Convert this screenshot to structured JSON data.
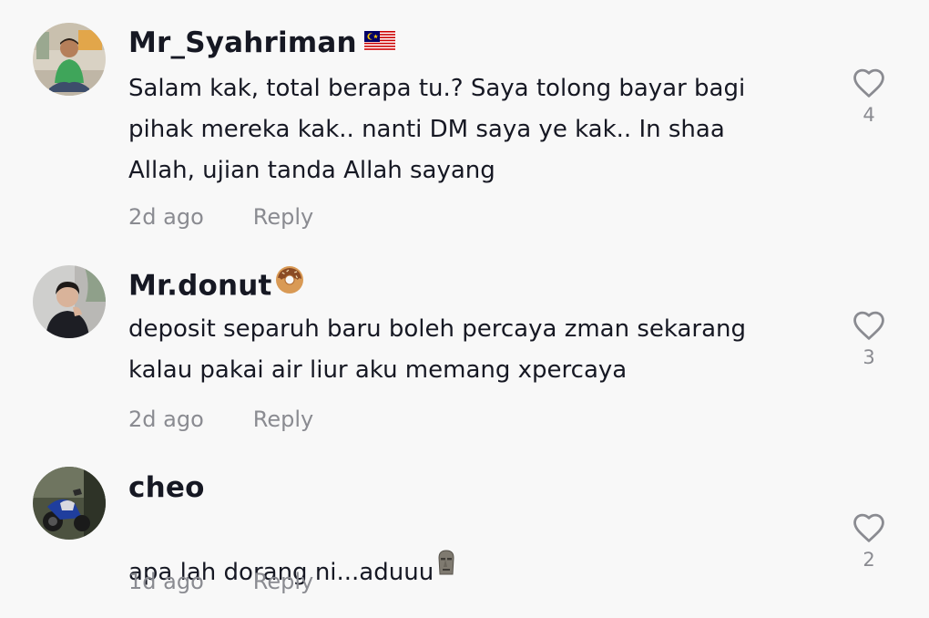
{
  "comments": [
    {
      "username": "Mr_Syahriman",
      "username_emoji": "malaysia-flag",
      "text": "Salam kak, total berapa tu.? Saya tolong bayar bagi\npihak mereka kak.. nanti DM saya ye kak.. In shaa\nAllah, ujian tanda Allah sayang",
      "time": "2d ago",
      "reply_label": "Reply",
      "likes": "4",
      "avatar_icon": "man-green-shirt-avatar"
    },
    {
      "username": "Mr.donut",
      "username_emoji": "donut-emoji",
      "text": "deposit separuh baru boleh percaya zman sekarang\nkalau pakai air liur aku memang xpercaya",
      "time": "2d ago",
      "reply_label": "Reply",
      "likes": "3",
      "avatar_icon": "man-dark-shirt-avatar"
    },
    {
      "username": "cheo",
      "username_emoji": "",
      "text": "apa lah dorang ni...aduuu",
      "text_emoji": "moai-emoji",
      "time": "1d ago",
      "reply_label": "Reply",
      "likes": "2",
      "avatar_icon": "motorcycle-avatar"
    }
  ],
  "colors": {
    "background": "#f8f8f8",
    "primary_text": "#161823",
    "secondary_text": "#8a8b91"
  }
}
